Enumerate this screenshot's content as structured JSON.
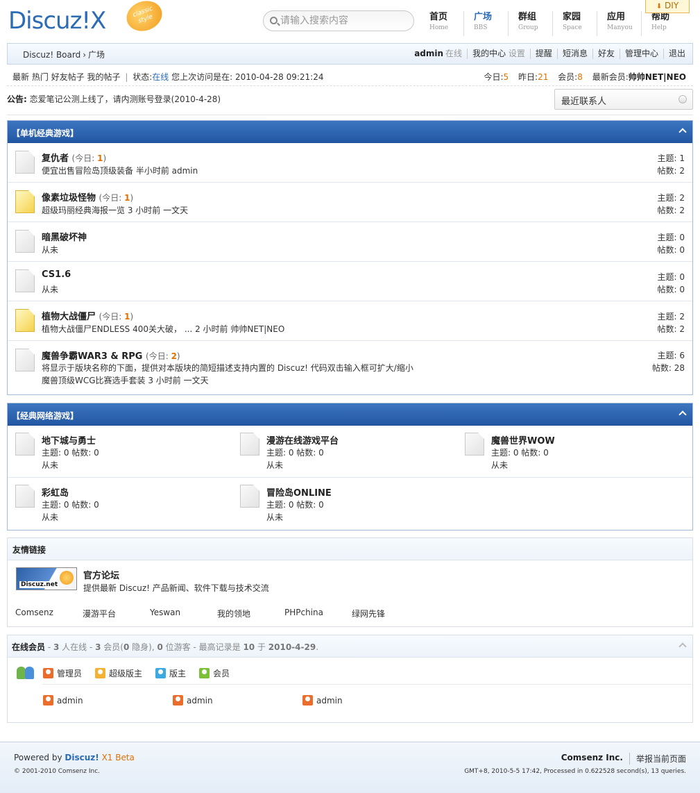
{
  "header": {
    "logo_text": "Discuz!X",
    "logo_badge": "classic style",
    "search_placeholder": "请输入搜索内容",
    "diy_label": "DIY",
    "nav": [
      {
        "cn": "首页",
        "en": "Home"
      },
      {
        "cn": "广场",
        "en": "BBS"
      },
      {
        "cn": "群组",
        "en": "Group"
      },
      {
        "cn": "家园",
        "en": "Space"
      },
      {
        "cn": "应用",
        "en": "Manyou"
      },
      {
        "cn": "帮助",
        "en": "Help"
      }
    ],
    "accent_color": "#2b6cb5"
  },
  "topbar": {
    "crumb_root": "Discuz! Board",
    "crumb_sep": "›",
    "crumb_current": "广场",
    "username": "admin",
    "online_label": "在线",
    "my_center": "我的中心",
    "settings": "设置",
    "remind": "提醒",
    "messages": "短消息",
    "friends": "好友",
    "admin_center": "管理中心",
    "logout": "退出"
  },
  "subbar": {
    "links": [
      "最新",
      "热门",
      "好友帖子",
      "我的帖子"
    ],
    "status_label": "状态:",
    "status_value": "在线",
    "last_visit_label": "您上次访问是在:",
    "last_visit": "2010-04-28 09:21:24",
    "today_label": "今日:",
    "today": "5",
    "yesterday_label": "昨日:",
    "yesterday": "21",
    "members_label": "会员:",
    "members": "8",
    "newest_label": "最新会员:",
    "newest": "帅帅NET|NEO"
  },
  "notice": {
    "label": "公告:",
    "text": "恋爱笔记公测上线了，请内测账号登录(2010-4-28)",
    "contacts": "最近联系人"
  },
  "section1": {
    "title": "【单机经典游戏】",
    "today_prefix": "(今日: ",
    "today_suffix": ")",
    "topics_label": "主题:",
    "posts_label": "帖数:",
    "forums": [
      {
        "name": "复仇者",
        "today": "1",
        "line1": "便宜出售冒险岛顶级装备 半小时前 admin",
        "line2": "",
        "topics": "1",
        "posts": "2",
        "new": false
      },
      {
        "name": "像素垃圾怪物",
        "today": "1",
        "line1": "超级玛丽经典海报一览 3 小时前 一文天",
        "line2": "",
        "topics": "2",
        "posts": "2",
        "new": true
      },
      {
        "name": "暗黑破坏神",
        "today": "",
        "line1": "从未",
        "line2": "",
        "topics": "0",
        "posts": "0",
        "new": false
      },
      {
        "name": "CS1.6",
        "today": "",
        "line1": "从未",
        "line2": "",
        "topics": "0",
        "posts": "0",
        "new": false
      },
      {
        "name": "植物大战僵尸",
        "today": "1",
        "line1": "植物大战僵尸ENDLESS 400关大破，  ... 2 小时前 帅帅NET|NEO",
        "line2": "",
        "topics": "2",
        "posts": "2",
        "new": true
      },
      {
        "name": "魔兽争霸WAR3 & RPG",
        "today": "2",
        "line1": "将显示于版块名称的下面，提供对本版块的简短描述支持内置的 Discuz! 代码双击输入框可扩大/缩小",
        "line2": "魔兽顶级WCG比赛选手套装 3 小时前 一文天",
        "topics": "6",
        "posts": "28",
        "new": false
      }
    ]
  },
  "section2": {
    "title": "【经典网络游戏】",
    "forums": [
      {
        "name": "地下城与勇士",
        "stats": "主题: 0 帖数: 0",
        "last": "从未"
      },
      {
        "name": "漫游在线游戏平台",
        "stats": "主题: 0 帖数: 0",
        "last": "从未"
      },
      {
        "name": "魔兽世界WOW",
        "stats": "主题: 0 帖数: 0",
        "last": "从未"
      },
      {
        "name": "彩虹岛",
        "stats": "主题: 0 帖数: 0",
        "last": "从未"
      },
      {
        "name": "冒险岛ONLINE",
        "stats": "主题: 0 帖数: 0",
        "last": "从未"
      }
    ]
  },
  "links": {
    "title": "友情链接",
    "logo_text": "Discuz.net",
    "featured_title": "官方论坛",
    "featured_desc": "提供最新 Discuz! 产品新闻、软件下载与技术交流",
    "text_links": [
      "Comsenz",
      "漫游平台",
      "Yeswan",
      "我的领地",
      "PHPchina",
      "绿网先锋"
    ]
  },
  "online": {
    "title": "在线会员",
    "summary_parts": [
      " - ",
      "3",
      " 人在线 - ",
      "3",
      " 会员(",
      "0",
      " 隐身), ",
      "0",
      " 位游客 - 最高记录是 ",
      "10",
      " 于 ",
      "2010-4-29",
      "."
    ],
    "legend": [
      "管理员",
      "超级版主",
      "版主",
      "会员"
    ],
    "users": [
      "admin",
      "admin",
      "admin"
    ]
  },
  "footer": {
    "powered_by": "Powered by",
    "brand": "Discuz!",
    "version": "X1 Beta",
    "copyright": "© 2001-2010 Comsenz Inc.",
    "company": "Comsenz Inc.",
    "report": "举报当前页面",
    "runtime": "GMT+8, 2010-5-5 17:42, Processed in 0.622528 second(s), 13 queries."
  }
}
